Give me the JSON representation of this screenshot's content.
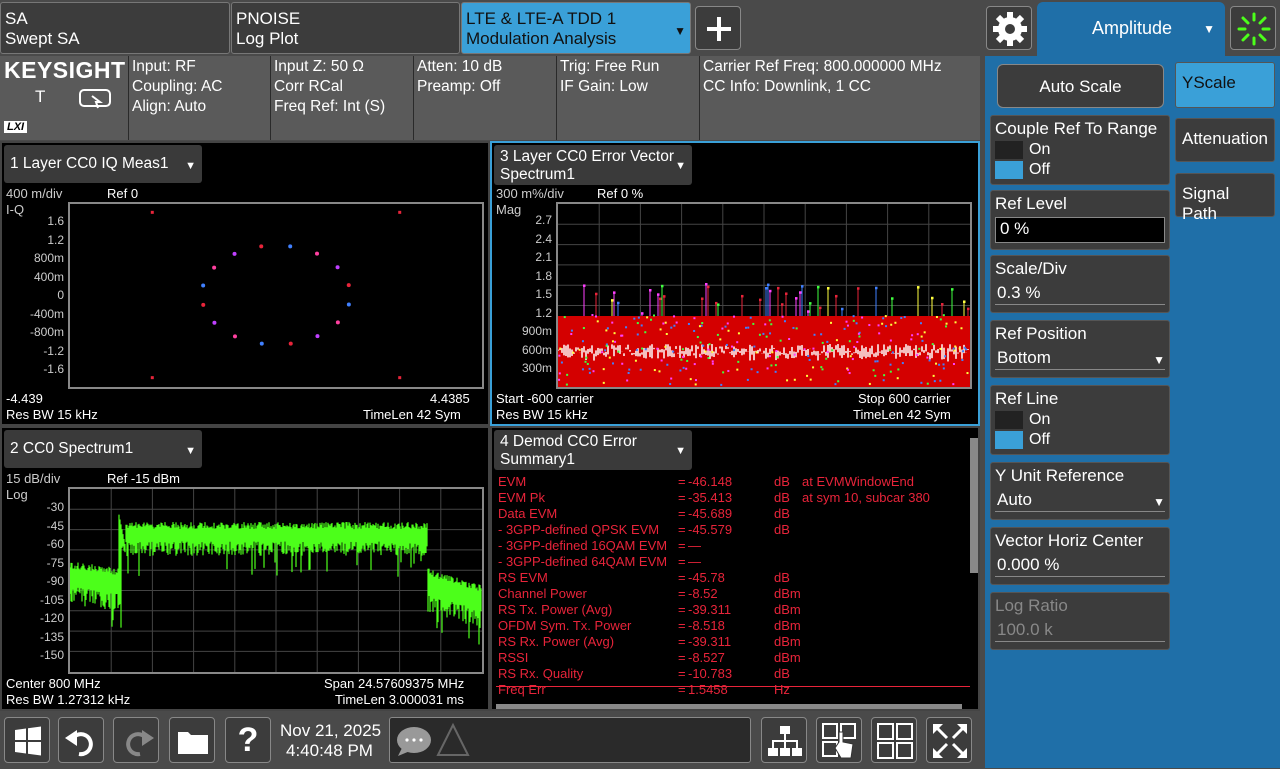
{
  "tabs": [
    {
      "line1": "SA",
      "line2": "Swept SA"
    },
    {
      "line1": "PNOISE",
      "line2": "Log Plot"
    },
    {
      "line1": "LTE & LTE-A TDD 1",
      "line2": "Modulation Analysis"
    }
  ],
  "menu_title": "Amplitude",
  "brand": "KEYSIGHT",
  "brand_t": "T",
  "brand_lxi": "LXI",
  "info": {
    "col1": [
      "Input: RF",
      "Coupling: AC",
      "Align: Auto"
    ],
    "col2": [
      "Input Z: 50 Ω",
      "Corr RCal",
      "Freq Ref: Int (S)"
    ],
    "col3": [
      "Atten: 10 dB",
      "Preamp: Off"
    ],
    "col4": [
      "Trig: Free Run",
      "IF Gain: Low"
    ],
    "col5": [
      "Carrier Ref Freq: 800.000000 MHz",
      "CC Info: Downlink, 1 CC"
    ]
  },
  "pane1": {
    "title": "1 Layer CC0 IQ Meas1",
    "scale": "400 m/div",
    "ref": "Ref 0",
    "ylabel": "I-Q",
    "yticks": [
      "1.6",
      "1.2",
      "800m",
      "400m",
      "0",
      "-400m",
      "-800m",
      "-1.2",
      "-1.6"
    ],
    "xmin": "-4.439",
    "xmax": "4.4385",
    "resbw": "Res BW 15 kHz",
    "timelen": "TimeLen 42  Sym"
  },
  "pane3": {
    "title1": "3 Layer CC0 Error Vector",
    "title2": "Spectrum1",
    "scale": "300 m%/div",
    "ref": "Ref 0 %",
    "ylabel": "Mag",
    "yticks": [
      "2.7",
      "2.4",
      "2.1",
      "1.8",
      "1.5",
      "1.2",
      "900m",
      "600m",
      "300m"
    ],
    "start": "Start -600  carrier",
    "stop": "Stop 600  carrier",
    "resbw": "Res BW 15 kHz",
    "timelen": "TimeLen 42  Sym"
  },
  "pane2": {
    "title": "2 CC0 Spectrum1",
    "scale": "15 dB/div",
    "ref": "Ref -15 dBm",
    "ylabel": "Log",
    "yticks": [
      "-30",
      "-45",
      "-60",
      "-75",
      "-90",
      "-105",
      "-120",
      "-135",
      "-150"
    ],
    "center": "Center 800 MHz",
    "span": "Span 24.57609375 MHz",
    "resbw": "Res BW 1.27312 kHz",
    "timelen": "TimeLen 3.000031 ms"
  },
  "pane4": {
    "title1": "4 Demod CC0 Error",
    "title2": "Summary1",
    "rows": [
      {
        "name": "EVM",
        "eq": "=",
        "val": "-46.148",
        "unit": "dB",
        "extra": "at   EVMWindowEnd"
      },
      {
        "name": "EVM Pk",
        "eq": "=",
        "val": "-35.413",
        "unit": "dB",
        "extra": "at   sym 10,   subcar  380"
      },
      {
        "name": "Data EVM",
        "eq": "=",
        "val": "-45.689",
        "unit": "dB",
        "extra": ""
      },
      {
        "name": " - 3GPP-defined QPSK EVM",
        "eq": "=",
        "val": "-45.579",
        "unit": "dB",
        "extra": ""
      },
      {
        "name": " - 3GPP-defined 16QAM EVM",
        "eq": "=",
        "val": "—",
        "unit": "",
        "extra": ""
      },
      {
        "name": " - 3GPP-defined 64QAM EVM",
        "eq": "=",
        "val": "—",
        "unit": "",
        "extra": ""
      },
      {
        "name": "RS EVM",
        "eq": "=",
        "val": "-45.78",
        "unit": "dB",
        "extra": ""
      },
      {
        "name": "Channel Power",
        "eq": "=",
        "val": "-8.52",
        "unit": "dBm",
        "extra": ""
      },
      {
        "name": "RS Tx. Power (Avg)",
        "eq": "=",
        "val": "-39.311",
        "unit": "dBm",
        "extra": ""
      },
      {
        "name": "OFDM Sym. Tx. Power",
        "eq": "=",
        "val": "-8.518",
        "unit": "dBm",
        "extra": ""
      },
      {
        "name": "RS Rx. Power (Avg)",
        "eq": "=",
        "val": "-39.311",
        "unit": "dBm",
        "extra": ""
      },
      {
        "name": "RSSI",
        "eq": "=",
        "val": "-8.527",
        "unit": "dBm",
        "extra": ""
      },
      {
        "name": "RS Rx. Quality",
        "eq": "=",
        "val": "-10.783",
        "unit": "dB",
        "extra": ""
      },
      {
        "name": "Freq Err",
        "eq": "=",
        "val": "1.5458",
        "unit": "Hz",
        "extra": ""
      }
    ]
  },
  "side": {
    "auto_scale": "Auto Scale",
    "couple_ref": "Couple Ref To Range",
    "on": "On",
    "off": "Off",
    "ref_level": "Ref Level",
    "ref_level_val": "0 %",
    "scale_div": "Scale/Div",
    "scale_div_val": "0.3 %",
    "ref_position": "Ref Position",
    "ref_position_val": "Bottom",
    "ref_line": "Ref Line",
    "y_unit_ref": "Y Unit Reference",
    "y_unit_ref_val": "Auto",
    "vec_horiz": "Vector Horiz Center",
    "vec_horiz_val": "0.000 %",
    "log_ratio": "Log Ratio",
    "log_ratio_val": "100.0 k",
    "tabs": [
      "YScale",
      "Attenuation",
      "Signal Path"
    ]
  },
  "status": {
    "date": "Nov 21, 2025",
    "time": "4:40:48 PM",
    "help": "?"
  },
  "colors": {
    "accent": "#3aa0d8",
    "trace_green": "#4cff1a",
    "summary_red": "#e8243a",
    "error_red": "#d40000"
  }
}
